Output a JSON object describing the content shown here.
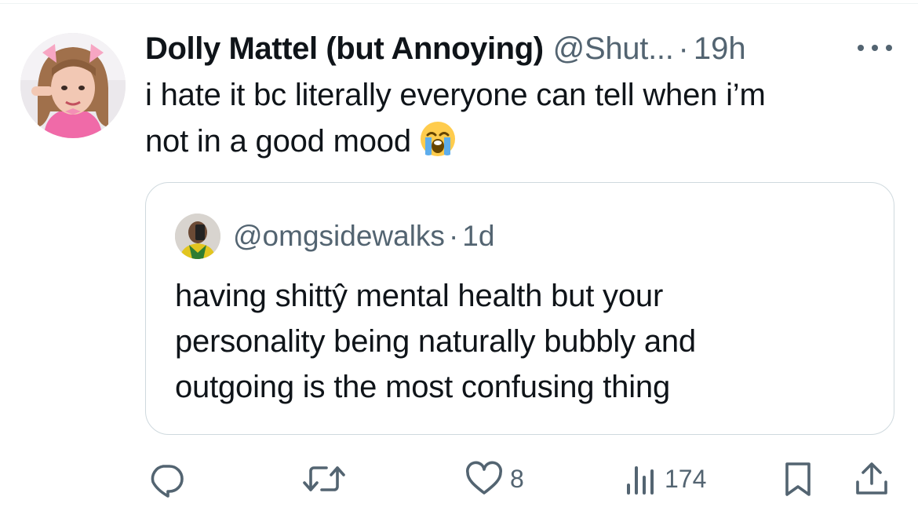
{
  "tweet": {
    "author_name": "Dolly Mattel (but Annoying)",
    "handle": "@Shut...",
    "separator": "·",
    "time": "19h",
    "text_line1": "i hate it bc literally everyone can tell when i’m",
    "text_line2": "not in a good mood",
    "emoji": "loudly-crying-face"
  },
  "quote": {
    "handle": "@omgsidewalks",
    "separator": "·",
    "time": "1d",
    "text_line1": "having shittŷ mental health but your",
    "text_line2": "personality being naturally bubbly and",
    "text_line3": "outgoing is the most confusing thing"
  },
  "actions": {
    "reply_icon": "reply-icon",
    "retweet_icon": "retweet-icon",
    "like_icon": "heart-icon",
    "like_count": "8",
    "views_icon": "views-icon",
    "views_count": "174",
    "bookmark_icon": "bookmark-icon",
    "share_icon": "share-icon"
  },
  "colors": {
    "text_primary": "#0f1419",
    "text_secondary": "#536471",
    "border": "#cfd9de"
  }
}
